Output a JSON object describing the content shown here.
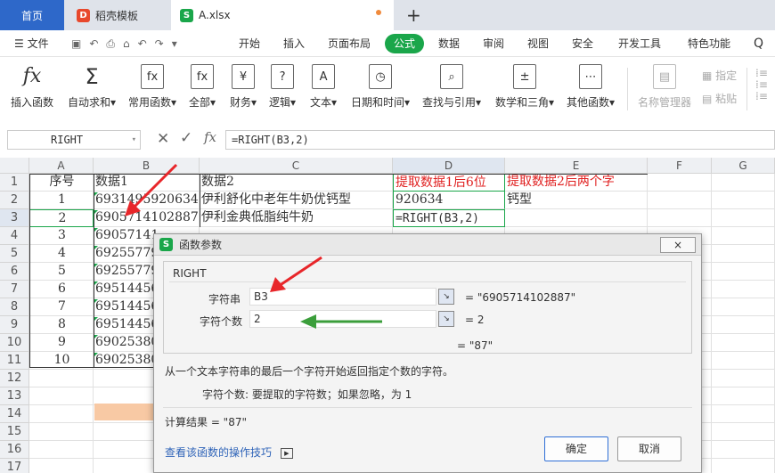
{
  "tabs": [
    {
      "label": "首页"
    },
    {
      "label": "稻壳模板"
    },
    {
      "label": "A.xlsx"
    }
  ],
  "new_tab_symbol": "+",
  "menu": {
    "file": "文件",
    "items": [
      "开始",
      "插入",
      "页面布局",
      "公式",
      "数据",
      "审阅",
      "视图",
      "安全",
      "开发工具",
      "特色功能"
    ],
    "active": "公式"
  },
  "ribbon": {
    "items": [
      {
        "label": "插入函数",
        "icon": "fx"
      },
      {
        "label": "自动求和",
        "icon": "Σ"
      },
      {
        "label": "常用函数",
        "icon": "fx"
      },
      {
        "label": "全部",
        "icon": "fx"
      },
      {
        "label": "财务",
        "icon": "¥"
      },
      {
        "label": "逻辑",
        "icon": "?"
      },
      {
        "label": "文本",
        "icon": "A"
      },
      {
        "label": "日期和时间",
        "icon": "◷"
      },
      {
        "label": "查找与引用",
        "icon": "⌕"
      },
      {
        "label": "数学和三角",
        "icon": "±"
      },
      {
        "label": "其他函数",
        "icon": "⋯"
      },
      {
        "label": "名称管理器",
        "icon": "▤"
      }
    ],
    "small": [
      "指定",
      "粘贴"
    ]
  },
  "formula_bar": {
    "name_box": "RIGHT",
    "fx": "fx",
    "formula": "=RIGHT(B3,2)"
  },
  "sheet": {
    "columns": [
      "A",
      "B",
      "C",
      "D",
      "E",
      "F",
      "G"
    ],
    "rows": [
      "1",
      "2",
      "3",
      "4",
      "5",
      "6",
      "7",
      "8",
      "9",
      "10",
      "11",
      "12",
      "13",
      "14",
      "15",
      "16",
      "17"
    ],
    "row1": {
      "A": "序号",
      "B": "数据1",
      "C": "数据2",
      "D": "提取数据1后6位",
      "E": "提取数据2后两个字"
    },
    "row2": {
      "A": "1",
      "B": "6931495920634",
      "C": "伊利舒化中老年牛奶优钙型",
      "D": "920634",
      "E": "钙型"
    },
    "row3": {
      "A": "2",
      "B": "6905714102887",
      "C": "伊利金典低脂纯牛奶",
      "D": "=RIGHT(B3,2)"
    },
    "row4": {
      "A": "3",
      "B": "69057141"
    },
    "row5": {
      "A": "4",
      "B": "69255779"
    },
    "row6": {
      "A": "5",
      "B": "69255779"
    },
    "row7": {
      "A": "6",
      "B": "69514456"
    },
    "row8": {
      "A": "7",
      "B": "69514456"
    },
    "row9": {
      "A": "8",
      "B": "69514456"
    },
    "row10": {
      "A": "9",
      "B": "69025380"
    },
    "row11": {
      "A": "10",
      "B": "69025380"
    }
  },
  "dialog": {
    "title": "函数参数",
    "close_symbol": "×",
    "function_name": "RIGHT",
    "arg1_label": "字符串",
    "arg1_value": "B3",
    "arg1_result": "= \"6905714102887\"",
    "arg2_label": "字符个数",
    "arg2_value": "2",
    "arg2_result": "= 2",
    "total_result": "= \"87\"",
    "description": "从一个文本字符串的最后一个字符开始返回指定个数的字符。",
    "arg_description": "字符个数:  要提取的字符数；如果忽略，为 1",
    "calc_result": "计算结果  =  \"87\"",
    "help_link": "查看该函数的操作技巧",
    "ok_label": "确定",
    "cancel_label": "取消"
  },
  "colors": {
    "accent_green": "#1aa64a",
    "tab_blue": "#2e68c9",
    "red_text": "#e02020",
    "arrow_red": "#e8262a",
    "arrow_green": "#3b9e3b"
  }
}
